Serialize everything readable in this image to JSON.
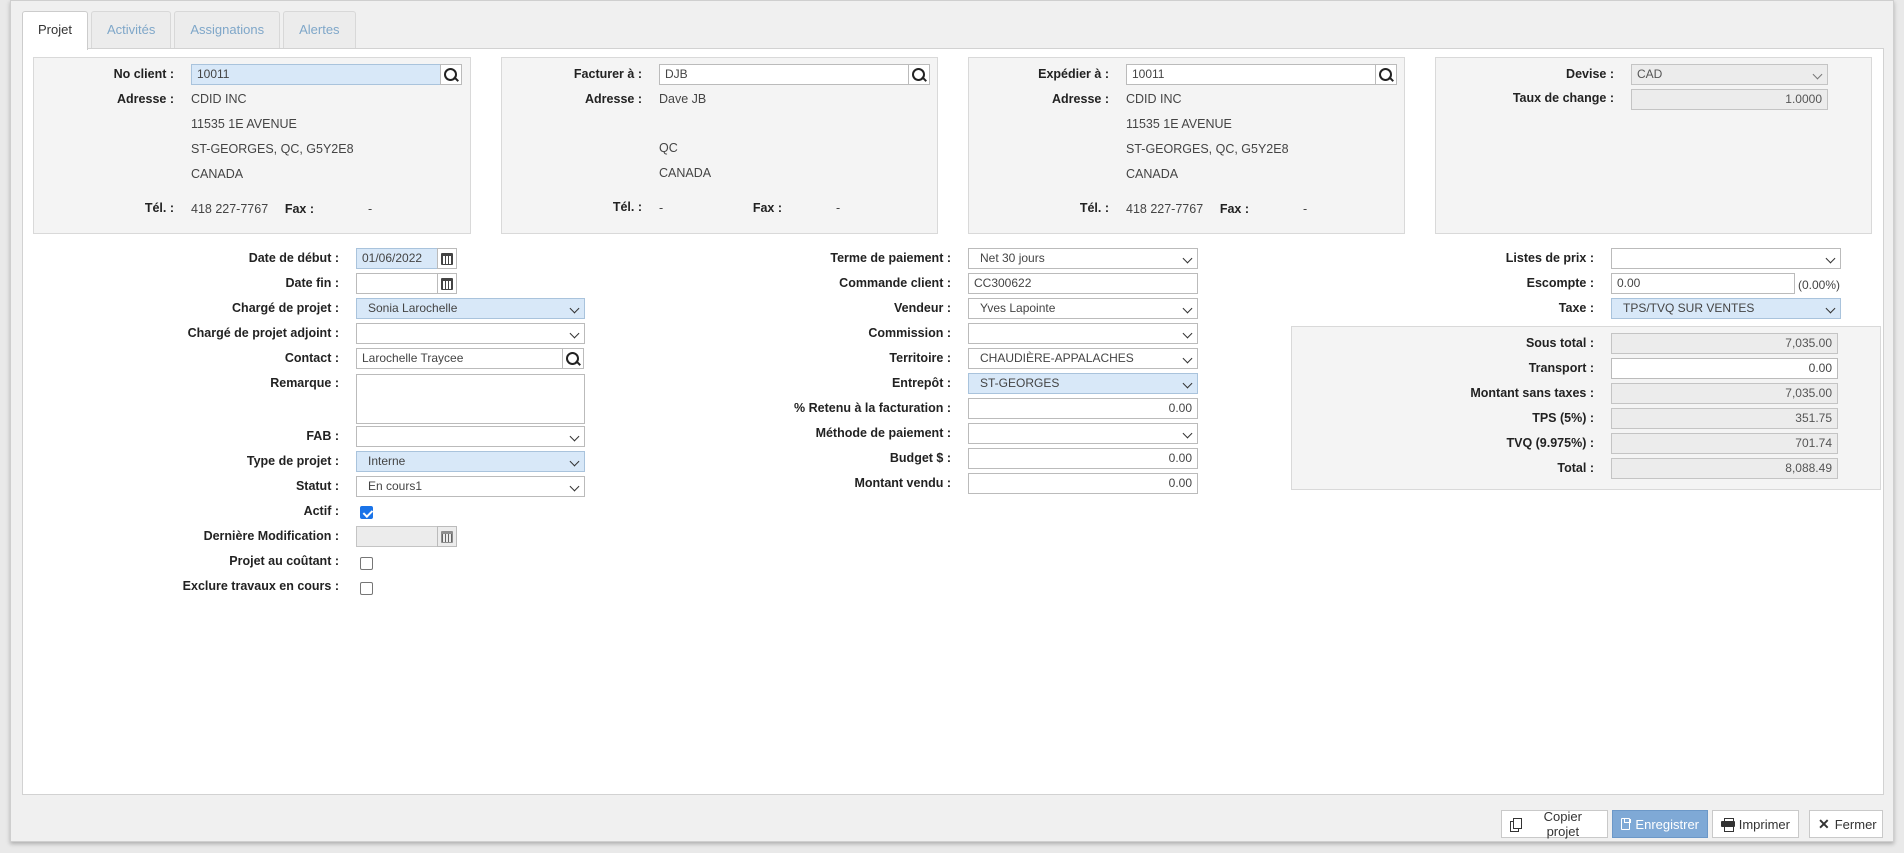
{
  "tabs": [
    {
      "label": "Projet",
      "active": true
    },
    {
      "label": "Activités"
    },
    {
      "label": "Assignations"
    },
    {
      "label": "Alertes"
    }
  ],
  "client": {
    "label": "No client :",
    "value": "10011",
    "address_label": "Adresse :",
    "address": [
      "CDID INC",
      "11535 1E AVENUE",
      "ST-GEORGES, QC, G5Y2E8",
      "CANADA"
    ],
    "tel_label": "Tél. :",
    "tel": "418 227-7767",
    "fax_label": "Fax :",
    "fax": "-"
  },
  "bill_to": {
    "label": "Facturer à :",
    "value": "DJB",
    "address_label": "Adresse :",
    "address": [
      "Dave JB",
      "",
      "QC",
      "CANADA"
    ],
    "tel_label": "Tél. :",
    "tel": "-",
    "fax_label": "Fax :",
    "fax": "-"
  },
  "ship_to": {
    "label": "Expédier à :",
    "value": "10011",
    "address_label": "Adresse :",
    "address": [
      "CDID INC",
      "11535 1E AVENUE",
      "ST-GEORGES, QC, G5Y2E8",
      "CANADA"
    ],
    "tel_label": "Tél. :",
    "tel": "418 227-7767",
    "fax_label": "Fax :",
    "fax": "-"
  },
  "currency": {
    "label": "Devise :",
    "value": "CAD",
    "rate_label": "Taux de change :",
    "rate": "1.0000"
  },
  "left": {
    "start_date_label": "Date de début :",
    "start_date": "01/06/2022",
    "end_date_label": "Date fin :",
    "end_date": "",
    "pm_label": "Chargé de projet :",
    "pm": "Sonia Larochelle",
    "apm_label": "Chargé de projet adjoint :",
    "apm": "",
    "contact_label": "Contact :",
    "contact": "Larochelle Traycee",
    "remark_label": "Remarque :",
    "remark": "",
    "fab_label": "FAB :",
    "fab": "",
    "type_label": "Type de projet :",
    "type": "Interne",
    "status_label": "Statut :",
    "status": "En cours1",
    "active_label": "Actif :",
    "active": true,
    "last_mod_label": "Dernière Modification :",
    "last_mod": "",
    "cost_label": "Projet au coûtant :",
    "cost": false,
    "exclude_label": "Exclure travaux en cours :",
    "exclude": false
  },
  "middle": {
    "terms_label": "Terme de paiement :",
    "terms": "Net 30 jours",
    "po_label": "Commande client :",
    "po": "CC300622",
    "seller_label": "Vendeur :",
    "seller": "Yves Lapointe",
    "commission_label": "Commission :",
    "commission": "",
    "territory_label": "Territoire :",
    "territory": "CHAUDIÈRE-APPALACHES",
    "warehouse_label": "Entrepôt :",
    "warehouse": "ST-GEORGES",
    "retain_label": "% Retenu à la facturation :",
    "retain": "0.00",
    "method_label": "Méthode de paiement :",
    "method": "",
    "budget_label": "Budget $ :",
    "budget": "0.00",
    "sold_label": "Montant vendu :",
    "sold": "0.00"
  },
  "right": {
    "pricelist_label": "Listes de prix :",
    "pricelist": "",
    "discount_label": "Escompte :",
    "discount": "0.00",
    "discount_pct": "(0.00%)",
    "tax_label": "Taxe :",
    "tax": "TPS/TVQ SUR VENTES"
  },
  "totals": [
    {
      "label": "Sous total :",
      "value": "7,035.00",
      "readonly": true
    },
    {
      "label": "Transport :",
      "value": "0.00",
      "readonly": false
    },
    {
      "label": "Montant sans taxes :",
      "value": "7,035.00",
      "readonly": true
    },
    {
      "label": "TPS (5%) :",
      "value": "351.75",
      "readonly": true
    },
    {
      "label": "TVQ (9.975%) :",
      "value": "701.74",
      "readonly": true
    },
    {
      "label": "Total :",
      "value": "8,088.49",
      "readonly": true
    }
  ],
  "footer": {
    "copy": "Copier projet",
    "save": "Enregistrer",
    "print": "Imprimer",
    "close": "Fermer"
  },
  "icons": [
    "search-icon",
    "calendar-icon",
    "chevron-down-icon",
    "copy-icon",
    "save-icon",
    "print-icon",
    "close-icon"
  ],
  "colors": {
    "highlight": "#d8e8f8",
    "primary_button": "#7fa9d6",
    "tab_inactive": "#7fa7c9",
    "checkbox": "#1a73e8"
  }
}
